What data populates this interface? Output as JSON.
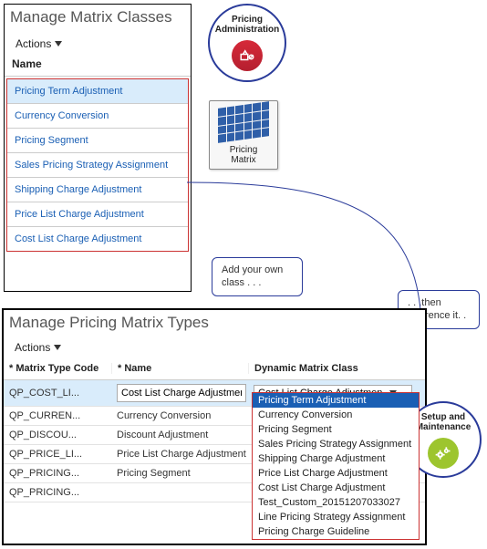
{
  "panel1": {
    "title": "Manage Matrix Classes",
    "actions_label": "Actions",
    "column_header": "Name",
    "items": [
      "Pricing Term Adjustment",
      "Currency Conversion",
      "Pricing Segment",
      "Sales Pricing Strategy Assignment",
      "Shipping Charge Adjustment",
      "Price List Charge Adjustment",
      "Cost List Charge Adjustment"
    ]
  },
  "pricing_admin": {
    "label1": "Pricing",
    "label2": "Administration"
  },
  "matrix_tile": {
    "label1": "Pricing",
    "label2": "Matrix"
  },
  "callout1": "Add your own class . . .",
  "callout2": ". . .then reference  it.    .",
  "panel2": {
    "title": "Manage Pricing Matrix Types",
    "actions_label": "Actions",
    "col_code": "Matrix Type Code",
    "col_name": "Name",
    "col_dyn": "Dynamic Matrix Class",
    "rows": [
      {
        "code": "QP_COST_LI...",
        "name": "Cost List Charge Adjustmen",
        "dyn": "Cost List Charge Adjustmen"
      },
      {
        "code": "QP_CURREN...",
        "name": "Currency Conversion"
      },
      {
        "code": "QP_DISCOU...",
        "name": "Discount Adjustment"
      },
      {
        "code": "QP_PRICE_LI...",
        "name": "Price List Charge Adjustment"
      },
      {
        "code": "QP_PRICING...",
        "name": "Pricing Segment"
      },
      {
        "code": "QP_PRICING...",
        "name": ""
      }
    ]
  },
  "dropdown": {
    "items": [
      "Pricing Term Adjustment",
      "Currency Conversion",
      "Pricing Segment",
      "Sales Pricing Strategy Assignment",
      "Shipping Charge Adjustment",
      "Price List Charge Adjustment",
      "Cost List Charge Adjustment",
      "Test_Custom_20151207033027",
      "Line Pricing Strategy Assignment",
      "Pricing Charge Guideline"
    ]
  },
  "setup_maint": {
    "label1": "Setup and",
    "label2": "Maintenance"
  }
}
